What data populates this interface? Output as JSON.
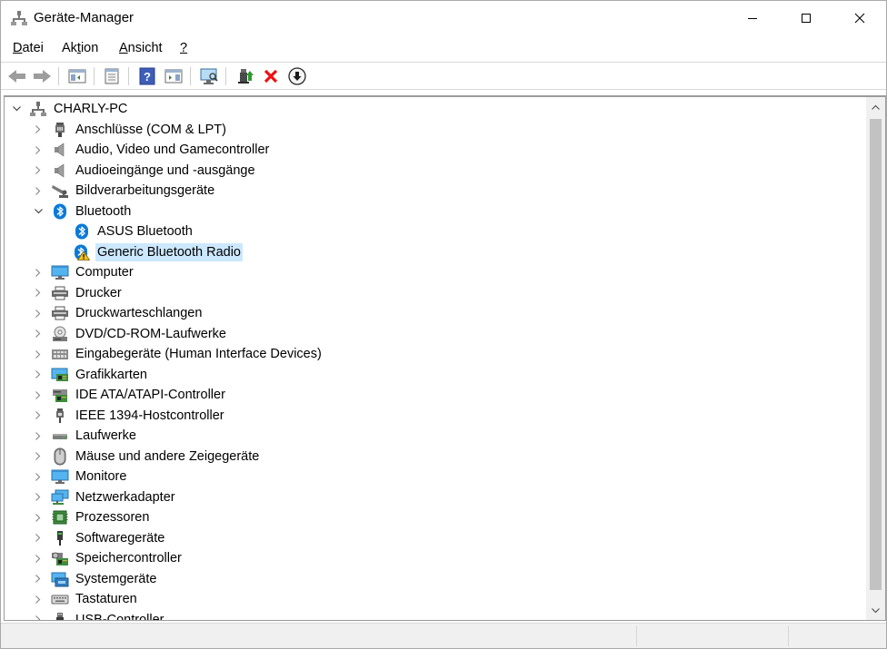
{
  "window": {
    "title": "Geräte-Manager",
    "icon": "device-manager-icon"
  },
  "menu": [
    {
      "label": "Datei",
      "mnemonic": "D",
      "rest": "atei"
    },
    {
      "label": "Aktion",
      "pre": "Ak",
      "mnemonic": "t",
      "rest": "ion"
    },
    {
      "label": "Ansicht",
      "mnemonic": "A",
      "rest": "nsicht"
    },
    {
      "label": "?",
      "mnemonic": "?",
      "rest": ""
    }
  ],
  "toolbar": [
    {
      "name": "back-button",
      "icon": "arrow-left-icon"
    },
    {
      "name": "forward-button",
      "icon": "arrow-right-icon"
    },
    {
      "name": "show-hide-console-tree-button",
      "icon": "console-tree-icon"
    },
    {
      "name": "properties-button",
      "icon": "properties-icon"
    },
    {
      "name": "help-button",
      "icon": "help-icon"
    },
    {
      "name": "action-pane-button",
      "icon": "action-pane-icon"
    },
    {
      "name": "scan-hardware-button",
      "icon": "monitor-scan-icon"
    },
    {
      "name": "update-driver-button",
      "icon": "update-driver-icon"
    },
    {
      "name": "uninstall-device-button",
      "icon": "red-x-icon"
    },
    {
      "name": "disable-device-button",
      "icon": "down-arrow-circle-icon"
    }
  ],
  "tree": {
    "root": {
      "label": "CHARLY-PC",
      "icon": "computer-root-icon",
      "expanded": true
    },
    "items": [
      {
        "label": "Anschlüsse (COM & LPT)",
        "icon": "port-icon",
        "level": 1,
        "expanded": false
      },
      {
        "label": "Audio, Video und Gamecontroller",
        "icon": "speaker-icon",
        "level": 1,
        "expanded": false
      },
      {
        "label": "Audioeingänge und -ausgänge",
        "icon": "speaker-icon",
        "level": 1,
        "expanded": false
      },
      {
        "label": "Bildverarbeitungsgeräte",
        "icon": "camera-icon",
        "level": 1,
        "expanded": false
      },
      {
        "label": "Bluetooth",
        "icon": "bluetooth-icon",
        "level": 1,
        "expanded": true
      },
      {
        "label": "ASUS Bluetooth",
        "icon": "bluetooth-icon",
        "level": 2
      },
      {
        "label": "Generic Bluetooth Radio",
        "icon": "bluetooth-warning-icon",
        "level": 2,
        "selected": true
      },
      {
        "label": "Computer",
        "icon": "monitor-icon",
        "level": 1,
        "expanded": false
      },
      {
        "label": "Drucker",
        "icon": "printer-icon",
        "level": 1,
        "expanded": false
      },
      {
        "label": "Druckwarteschlangen",
        "icon": "printer-icon",
        "level": 1,
        "expanded": false
      },
      {
        "label": "DVD/CD-ROM-Laufwerke",
        "icon": "disc-drive-icon",
        "level": 1,
        "expanded": false
      },
      {
        "label": "Eingabegeräte (Human Interface Devices)",
        "icon": "hid-icon",
        "level": 1,
        "expanded": false
      },
      {
        "label": "Grafikkarten",
        "icon": "display-adapter-icon",
        "level": 1,
        "expanded": false
      },
      {
        "label": "IDE ATA/ATAPI-Controller",
        "icon": "ide-controller-icon",
        "level": 1,
        "expanded": false
      },
      {
        "label": "IEEE 1394-Hostcontroller",
        "icon": "firewire-icon",
        "level": 1,
        "expanded": false
      },
      {
        "label": "Laufwerke",
        "icon": "disk-drive-icon",
        "level": 1,
        "expanded": false
      },
      {
        "label": "Mäuse und andere Zeigegeräte",
        "icon": "mouse-icon",
        "level": 1,
        "expanded": false
      },
      {
        "label": "Monitore",
        "icon": "monitor-icon",
        "level": 1,
        "expanded": false
      },
      {
        "label": "Netzwerkadapter",
        "icon": "network-adapter-icon",
        "level": 1,
        "expanded": false
      },
      {
        "label": "Prozessoren",
        "icon": "processor-icon",
        "level": 1,
        "expanded": false
      },
      {
        "label": "Softwaregeräte",
        "icon": "software-device-icon",
        "level": 1,
        "expanded": false
      },
      {
        "label": "Speichercontroller",
        "icon": "storage-controller-icon",
        "level": 1,
        "expanded": false
      },
      {
        "label": "Systemgeräte",
        "icon": "system-device-icon",
        "level": 1,
        "expanded": false
      },
      {
        "label": "Tastaturen",
        "icon": "keyboard-icon",
        "level": 1,
        "expanded": false
      },
      {
        "label": "USB-Controller",
        "icon": "usb-icon",
        "level": 1,
        "expanded": false
      }
    ]
  },
  "colors": {
    "selection": "#cce8ff",
    "bluetooth": "#0078d7",
    "warning": "#f5c518",
    "scroll_track": "#f0f0f0",
    "scroll_thumb": "#c2c2c2"
  }
}
